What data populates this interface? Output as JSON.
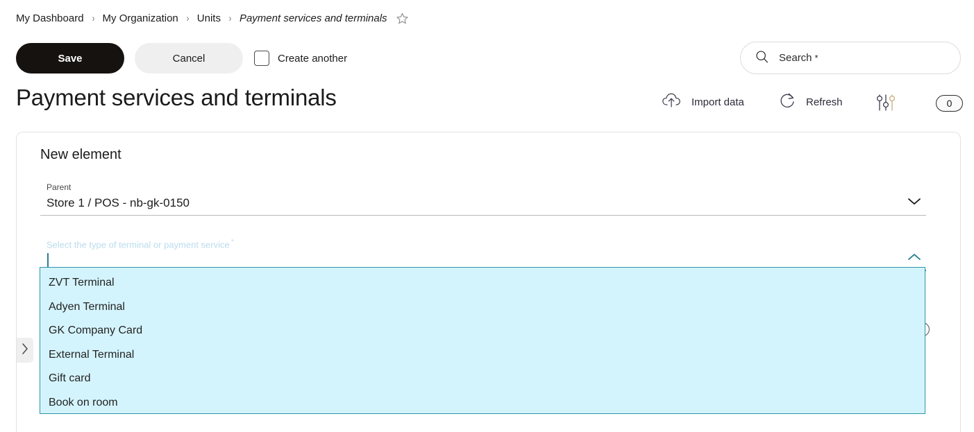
{
  "breadcrumb": {
    "items": [
      {
        "label": "My Dashboard"
      },
      {
        "label": "My Organization"
      },
      {
        "label": "Units"
      }
    ],
    "separator": "›",
    "current": "Payment services and terminals",
    "favorite_icon": "star-outline-icon"
  },
  "actions": {
    "save_label": "Save",
    "cancel_label": "Cancel",
    "create_another_label": "Create another",
    "create_another_checked": false
  },
  "search": {
    "placeholder": "Search",
    "required_marker": "*",
    "icon": "search-icon"
  },
  "header": {
    "title": "Payment services and terminals",
    "import_label": "Import data",
    "import_icon": "cloud-upload-icon",
    "refresh_label": "Refresh",
    "refresh_icon": "refresh-icon",
    "filters_icon": "sliders-icon",
    "badge_count": "0"
  },
  "card": {
    "title": "New element",
    "parent_field": {
      "label": "Parent",
      "value": "Store 1 / POS - nb-gk-0150",
      "chevron": "chevron-down-icon"
    },
    "type_field": {
      "label": "Select the type of terminal or payment service",
      "required_marker": "*",
      "value": "",
      "chevron": "chevron-up-icon",
      "focused": true
    },
    "info_icon": "info-circle-icon"
  },
  "dropdown": {
    "options": [
      {
        "label": "ZVT Terminal"
      },
      {
        "label": "Adyen Terminal"
      },
      {
        "label": "GK Company Card"
      },
      {
        "label": "External Terminal"
      },
      {
        "label": "Gift card"
      },
      {
        "label": "Book on room"
      }
    ]
  },
  "panel": {
    "handle_icon": "chevron-right-icon"
  },
  "colors": {
    "accent_teal": "#2e94a8",
    "dropdown_bg": "#d4f4fd",
    "save_bg": "#15120f",
    "cancel_bg": "#efefef"
  }
}
